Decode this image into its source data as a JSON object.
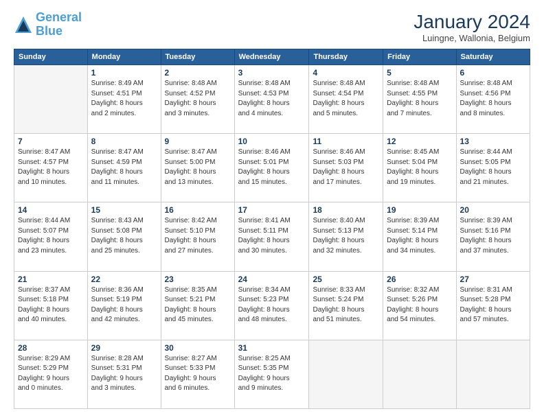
{
  "logo": {
    "line1": "General",
    "line2": "Blue"
  },
  "title": "January 2024",
  "location": "Luingne, Wallonia, Belgium",
  "days_header": [
    "Sunday",
    "Monday",
    "Tuesday",
    "Wednesday",
    "Thursday",
    "Friday",
    "Saturday"
  ],
  "weeks": [
    [
      {
        "day": "",
        "info": ""
      },
      {
        "day": "1",
        "info": "Sunrise: 8:49 AM\nSunset: 4:51 PM\nDaylight: 8 hours\nand 2 minutes."
      },
      {
        "day": "2",
        "info": "Sunrise: 8:48 AM\nSunset: 4:52 PM\nDaylight: 8 hours\nand 3 minutes."
      },
      {
        "day": "3",
        "info": "Sunrise: 8:48 AM\nSunset: 4:53 PM\nDaylight: 8 hours\nand 4 minutes."
      },
      {
        "day": "4",
        "info": "Sunrise: 8:48 AM\nSunset: 4:54 PM\nDaylight: 8 hours\nand 5 minutes."
      },
      {
        "day": "5",
        "info": "Sunrise: 8:48 AM\nSunset: 4:55 PM\nDaylight: 8 hours\nand 7 minutes."
      },
      {
        "day": "6",
        "info": "Sunrise: 8:48 AM\nSunset: 4:56 PM\nDaylight: 8 hours\nand 8 minutes."
      }
    ],
    [
      {
        "day": "7",
        "info": "Sunrise: 8:47 AM\nSunset: 4:57 PM\nDaylight: 8 hours\nand 10 minutes."
      },
      {
        "day": "8",
        "info": "Sunrise: 8:47 AM\nSunset: 4:59 PM\nDaylight: 8 hours\nand 11 minutes."
      },
      {
        "day": "9",
        "info": "Sunrise: 8:47 AM\nSunset: 5:00 PM\nDaylight: 8 hours\nand 13 minutes."
      },
      {
        "day": "10",
        "info": "Sunrise: 8:46 AM\nSunset: 5:01 PM\nDaylight: 8 hours\nand 15 minutes."
      },
      {
        "day": "11",
        "info": "Sunrise: 8:46 AM\nSunset: 5:03 PM\nDaylight: 8 hours\nand 17 minutes."
      },
      {
        "day": "12",
        "info": "Sunrise: 8:45 AM\nSunset: 5:04 PM\nDaylight: 8 hours\nand 19 minutes."
      },
      {
        "day": "13",
        "info": "Sunrise: 8:44 AM\nSunset: 5:05 PM\nDaylight: 8 hours\nand 21 minutes."
      }
    ],
    [
      {
        "day": "14",
        "info": "Sunrise: 8:44 AM\nSunset: 5:07 PM\nDaylight: 8 hours\nand 23 minutes."
      },
      {
        "day": "15",
        "info": "Sunrise: 8:43 AM\nSunset: 5:08 PM\nDaylight: 8 hours\nand 25 minutes."
      },
      {
        "day": "16",
        "info": "Sunrise: 8:42 AM\nSunset: 5:10 PM\nDaylight: 8 hours\nand 27 minutes."
      },
      {
        "day": "17",
        "info": "Sunrise: 8:41 AM\nSunset: 5:11 PM\nDaylight: 8 hours\nand 30 minutes."
      },
      {
        "day": "18",
        "info": "Sunrise: 8:40 AM\nSunset: 5:13 PM\nDaylight: 8 hours\nand 32 minutes."
      },
      {
        "day": "19",
        "info": "Sunrise: 8:39 AM\nSunset: 5:14 PM\nDaylight: 8 hours\nand 34 minutes."
      },
      {
        "day": "20",
        "info": "Sunrise: 8:39 AM\nSunset: 5:16 PM\nDaylight: 8 hours\nand 37 minutes."
      }
    ],
    [
      {
        "day": "21",
        "info": "Sunrise: 8:37 AM\nSunset: 5:18 PM\nDaylight: 8 hours\nand 40 minutes."
      },
      {
        "day": "22",
        "info": "Sunrise: 8:36 AM\nSunset: 5:19 PM\nDaylight: 8 hours\nand 42 minutes."
      },
      {
        "day": "23",
        "info": "Sunrise: 8:35 AM\nSunset: 5:21 PM\nDaylight: 8 hours\nand 45 minutes."
      },
      {
        "day": "24",
        "info": "Sunrise: 8:34 AM\nSunset: 5:23 PM\nDaylight: 8 hours\nand 48 minutes."
      },
      {
        "day": "25",
        "info": "Sunrise: 8:33 AM\nSunset: 5:24 PM\nDaylight: 8 hours\nand 51 minutes."
      },
      {
        "day": "26",
        "info": "Sunrise: 8:32 AM\nSunset: 5:26 PM\nDaylight: 8 hours\nand 54 minutes."
      },
      {
        "day": "27",
        "info": "Sunrise: 8:31 AM\nSunset: 5:28 PM\nDaylight: 8 hours\nand 57 minutes."
      }
    ],
    [
      {
        "day": "28",
        "info": "Sunrise: 8:29 AM\nSunset: 5:29 PM\nDaylight: 9 hours\nand 0 minutes."
      },
      {
        "day": "29",
        "info": "Sunrise: 8:28 AM\nSunset: 5:31 PM\nDaylight: 9 hours\nand 3 minutes."
      },
      {
        "day": "30",
        "info": "Sunrise: 8:27 AM\nSunset: 5:33 PM\nDaylight: 9 hours\nand 6 minutes."
      },
      {
        "day": "31",
        "info": "Sunrise: 8:25 AM\nSunset: 5:35 PM\nDaylight: 9 hours\nand 9 minutes."
      },
      {
        "day": "",
        "info": ""
      },
      {
        "day": "",
        "info": ""
      },
      {
        "day": "",
        "info": ""
      }
    ]
  ]
}
